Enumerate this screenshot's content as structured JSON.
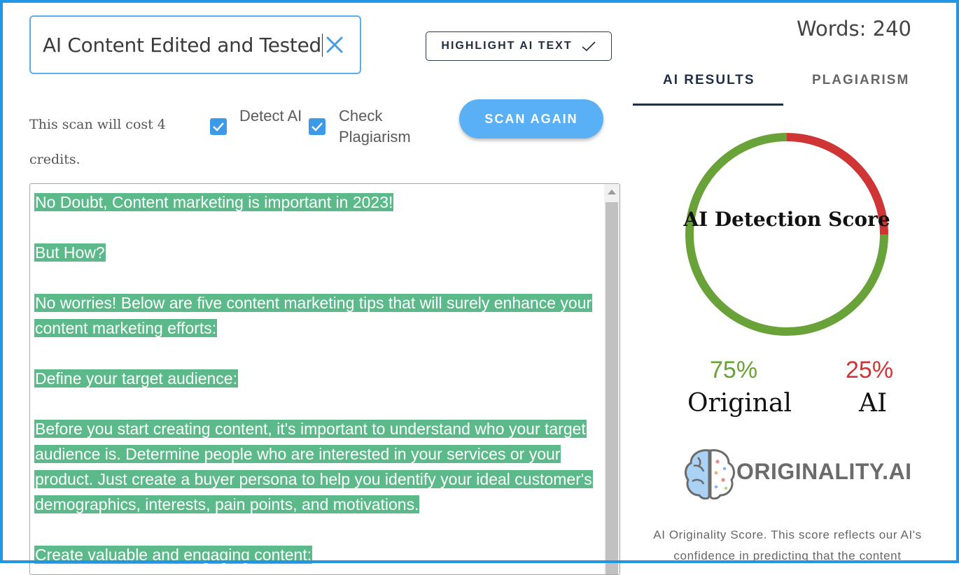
{
  "title_input": {
    "value": "AI Content Edited and Tested"
  },
  "highlight_button": {
    "label": "HIGHLIGHT AI TEXT"
  },
  "scan": {
    "cost_text": "This scan will cost 4 credits.",
    "detect_ai": {
      "label": "Detect AI",
      "checked": true
    },
    "check_plagiarism": {
      "label": "Check Plagiarism",
      "checked": true
    },
    "button_label": "SCAN AGAIN"
  },
  "content": {
    "paragraphs": [
      "No Doubt, Content marketing is important in 2023!",
      "But How?",
      "No worries! Below are five content marketing tips that will surely enhance your content marketing efforts:",
      "Define your target audience:",
      "Before you start creating content, it's important to understand who your target audience is. Determine people who are interested in your services or your product. Just create a buyer persona to help you identify your ideal customer's demographics, interests, pain points, and motivations.",
      "Create valuable and engaging content:"
    ],
    "highlight_color": "#5bb98a"
  },
  "stats": {
    "words": "Words: 240"
  },
  "tabs": [
    {
      "label": "AI RESULTS",
      "active": true
    },
    {
      "label": "PLAGIARISM",
      "active": false
    }
  ],
  "gauge": {
    "title": "AI Detection Score",
    "original_percent": 75,
    "ai_percent": 25,
    "original_value": "75%",
    "ai_value": "25%",
    "original_label": "Original",
    "ai_label": "AI",
    "original_color": "#6aa23a",
    "ai_color": "#d03535"
  },
  "brand": {
    "name": "ORIGINALITY.AI"
  },
  "description": "AI Originality Score. This score reflects our AI's confidence in predicting that the content"
}
